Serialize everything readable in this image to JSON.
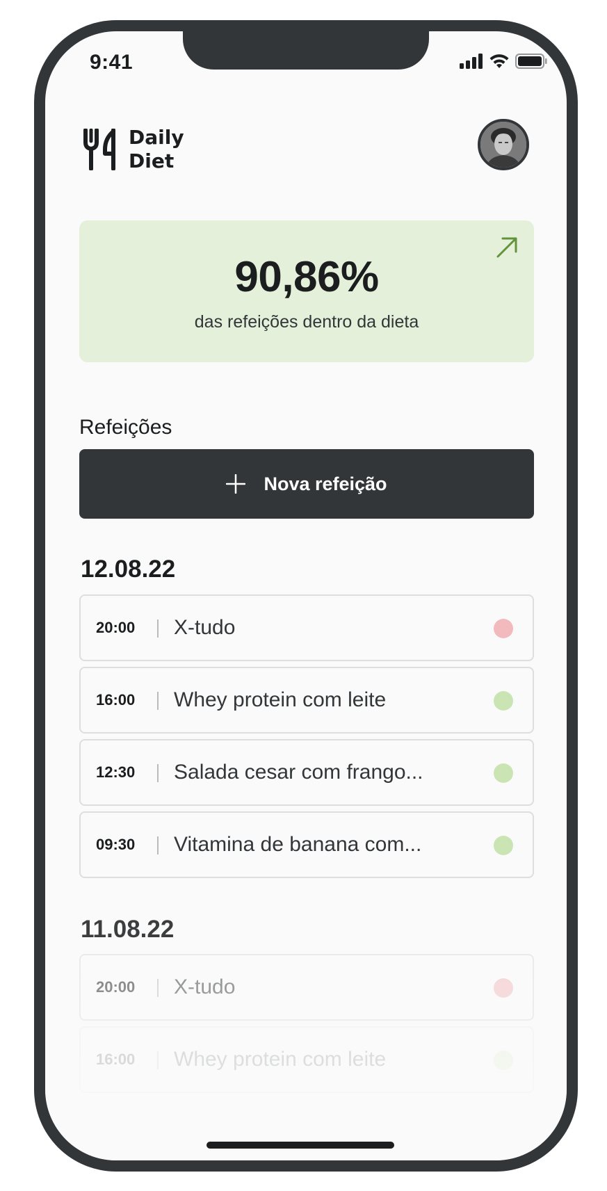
{
  "status_bar": {
    "time": "9:41",
    "icons": [
      "signal-icon",
      "wifi-icon",
      "battery-icon"
    ]
  },
  "header": {
    "logo_text": "Daily\nDiet",
    "logo_icon": "fork-knife-icon",
    "avatar": "user-avatar"
  },
  "stats": {
    "percent": "90,86%",
    "label": "das refeições dentro da dieta",
    "icon": "arrow-up-right-icon",
    "bg_color": "#E5F0DB",
    "accent_color": "#639339"
  },
  "meals_section": {
    "title": "Refeições",
    "new_button_label": "Nova refeição",
    "new_button_icon": "plus-icon"
  },
  "days": [
    {
      "date": "12.08.22",
      "meals": [
        {
          "time": "20:00",
          "name": "X-tudo",
          "in_diet": false
        },
        {
          "time": "16:00",
          "name": "Whey protein com leite",
          "in_diet": true
        },
        {
          "time": "12:30",
          "name": "Salada cesar com frango...",
          "in_diet": true
        },
        {
          "time": "09:30",
          "name": "Vitamina de banana com...",
          "in_diet": true
        }
      ]
    },
    {
      "date": "11.08.22",
      "meals": [
        {
          "time": "20:00",
          "name": "X-tudo",
          "in_diet": false
        },
        {
          "time": "16:00",
          "name": "Whey protein com leite",
          "in_diet": true
        }
      ]
    }
  ],
  "colors": {
    "dark": "#333638",
    "in_diet_dot": "#CBE4B4",
    "off_diet_dot": "#F3BABD"
  }
}
